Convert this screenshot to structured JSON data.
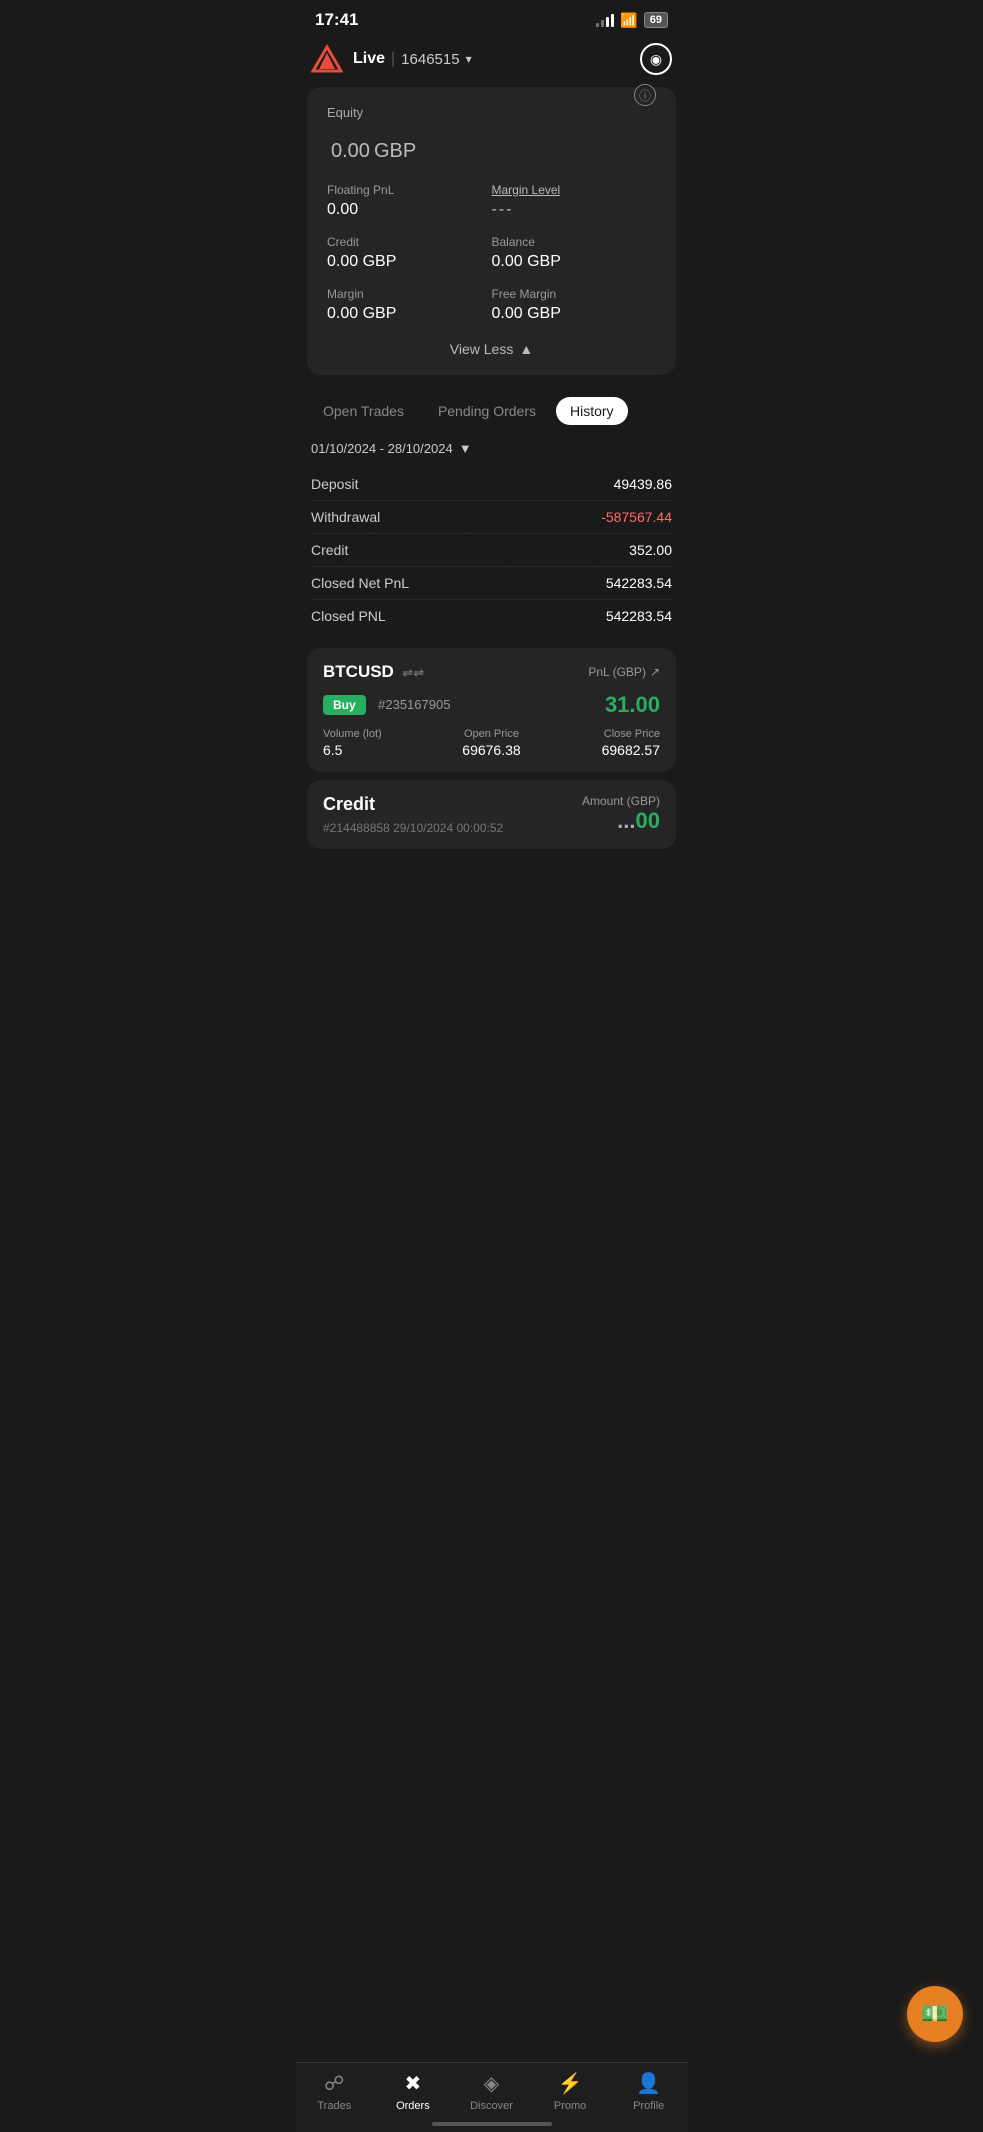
{
  "statusBar": {
    "time": "17:41",
    "battery": "69"
  },
  "header": {
    "accountType": "Live",
    "accountNumber": "1646515",
    "dropdownLabel": "▾"
  },
  "accountCard": {
    "equityLabel": "Equity",
    "equityValue": "0.00",
    "equityCurrency": "GBP",
    "floatingPnlLabel": "Floating PnL",
    "floatingPnlValue": "0.00",
    "marginLevelLabel": "Margin Level",
    "marginLevelValue": "---",
    "creditLabel": "Credit",
    "creditValue": "0.00 GBP",
    "balanceLabel": "Balance",
    "balanceValue": "0.00 GBP",
    "marginLabel": "Margin",
    "marginValue": "0.00 GBP",
    "freeMarginLabel": "Free Margin",
    "freeMarginValue": "0.00 GBP",
    "viewLessLabel": "View Less"
  },
  "tabs": {
    "openTrades": "Open Trades",
    "pendingOrders": "Pending Orders",
    "history": "History"
  },
  "dateRange": {
    "value": "01/10/2024 - 28/10/2024"
  },
  "historyRows": [
    {
      "label": "Deposit",
      "value": "49439.86",
      "negative": false
    },
    {
      "label": "Withdrawal",
      "value": "-587567.44",
      "negative": true
    },
    {
      "label": "Credit",
      "value": "352.00",
      "negative": false
    },
    {
      "label": "Closed Net PnL",
      "value": "542283.54",
      "negative": false
    },
    {
      "label": "Closed PNL",
      "value": "542283.54",
      "negative": false
    }
  ],
  "tradeCard": {
    "symbol": "BTCUSD",
    "pnlLabel": "PnL (GBP)",
    "direction": "Buy",
    "orderNumber": "#235167905",
    "pnlValue": "31.00",
    "volumeLabel": "Volume (lot)",
    "volumeValue": "6.5",
    "openPriceLabel": "Open Price",
    "openPriceValue": "69676.38",
    "closePriceLabel": "Close Price",
    "closePriceValue": "69682.57"
  },
  "creditCard": {
    "title": "Credit",
    "orderNumber": "#214488858",
    "dateTime": "29/10/2024 00:00:52",
    "amountLabel": "Amount (GBP)",
    "amountValue": "00"
  },
  "bottomNav": {
    "items": [
      {
        "label": "Trades",
        "icon": "📊",
        "active": false
      },
      {
        "label": "Orders",
        "icon": "↗",
        "active": true
      },
      {
        "label": "Discover",
        "icon": "◈",
        "active": false
      },
      {
        "label": "Promo",
        "icon": "⚡",
        "active": false
      },
      {
        "label": "Profile",
        "icon": "👤",
        "active": false
      }
    ]
  }
}
